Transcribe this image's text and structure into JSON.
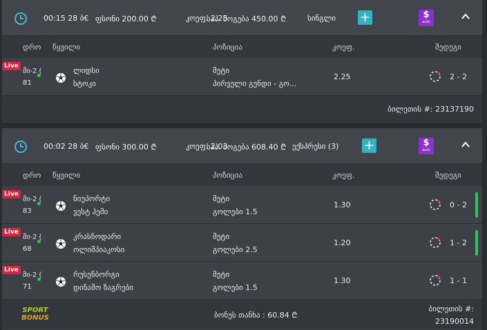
{
  "columns": {
    "time": "დრო",
    "match": "წყვილი",
    "position": "პოზიცია",
    "coef": "კოეფ.",
    "result": "შედეგი"
  },
  "colors": {
    "accent_plus": "#2fb4c6",
    "auto_button": "#8e2fd0",
    "live_badge": "#e0233b",
    "status_bar": "#2fc45a"
  },
  "tickets": [
    {
      "header": {
        "time": "00:15 28 ბ€",
        "stake": "ფსონი  200.00  ₾",
        "coef": "კოეფ.  2.25",
        "win": "საპ. მოგება  450.00  ₾",
        "type": "სინგლი",
        "plus_icon": "+",
        "auto_dollar": "$",
        "auto_text": "auto"
      },
      "rows": [
        {
          "live": "Live",
          "period": "მი-2 (",
          "minute": "81",
          "team1": "ლიდსი",
          "team2": "სტოკი",
          "pos1": "მეტი",
          "pos2": "პირველი გუნდი - გო...",
          "coef": "2.25",
          "score": "2 - 2"
        }
      ],
      "footer": {
        "ticket_label": "ბილეთის #: 23137190"
      }
    },
    {
      "header": {
        "time": "00:02 28 ბ€",
        "stake": "ფსონი  300.00  ₾",
        "coef": "კოეფ.  2.03",
        "win": "საპ. მოგება  608.40  ₾",
        "type": "ექსპრესი (3)",
        "plus_icon": "+",
        "auto_dollar": "$",
        "auto_text": "auto"
      },
      "rows": [
        {
          "live": "Live",
          "period": "მი-2 (",
          "minute": "83",
          "team1": "ნიუპორტი",
          "team2": "ვესტ ჰემი",
          "pos1": "მეტი",
          "pos2": "გოლები 1.5",
          "coef": "1.30",
          "score": "0 - 2"
        },
        {
          "live": "Live",
          "period": "მი-2 (",
          "minute": "68",
          "team1": "კრასნოდარი",
          "team2": "ოლიმპიაკოსი",
          "pos1": "მეტი",
          "pos2": "გოლები 2.5",
          "coef": "1.20",
          "score": "1 - 2"
        },
        {
          "live": "Live",
          "period": "მი-2 (",
          "minute": "71",
          "team1": "რუსენბორგი",
          "team2": "დინამო ზაგრები",
          "pos1": "მეტი",
          "pos2": "გოლები 1.5",
          "coef": "1.30",
          "score": "1 - 1"
        }
      ],
      "footer": {
        "sport_bonus_line1": "SPORT",
        "sport_bonus_line2": "BONUS",
        "bonus_sum": "ბონუს თანხა : 60.84  ₾",
        "ticket_label_1": "ბილეთის #:",
        "ticket_label_2": "23190014"
      }
    }
  ]
}
